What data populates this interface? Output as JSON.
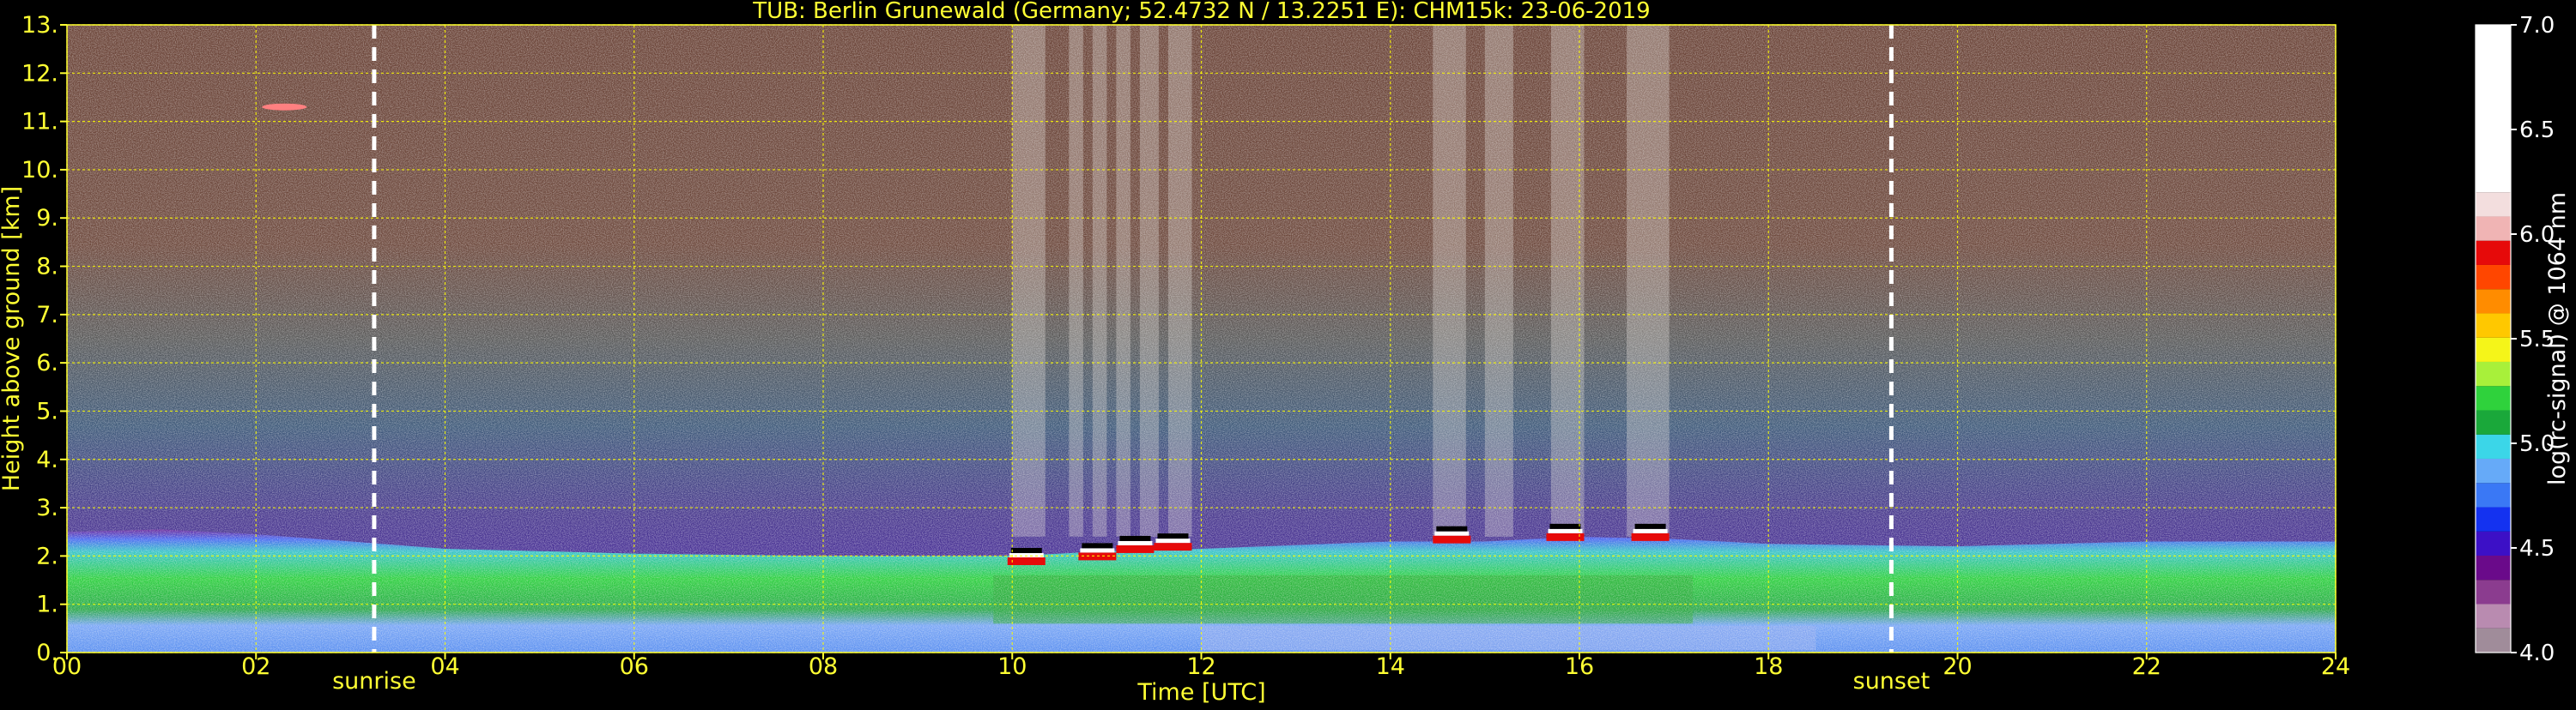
{
  "chart_data": {
    "type": "heatmap",
    "title": "TUB: Berlin Grunewald (Germany; 52.4732 N / 13.2251 E):    CHM15k: 23-06-2019",
    "xlabel": "Time [UTC]",
    "ylabel": "Height above ground [km]",
    "xlim": [
      0,
      24
    ],
    "ylim": [
      0,
      13
    ],
    "x_ticks": [
      "00",
      "02",
      "04",
      "06",
      "08",
      "10",
      "12",
      "14",
      "16",
      "18",
      "20",
      "22",
      "24"
    ],
    "y_ticks": [
      "0.",
      "1.",
      "2.",
      "3.",
      "4.",
      "5.",
      "6.",
      "7.",
      "8.",
      "9.",
      "10.",
      "11.",
      "12.",
      "13."
    ],
    "grid": true,
    "colorbar": {
      "label": "log(rc-signal) @ 1064 nm",
      "range": [
        4.0,
        7.0
      ],
      "ticks": [
        "4.0",
        "4.5",
        "5.0",
        "5.5",
        "6.0",
        "6.5",
        "7.0"
      ]
    },
    "annotations": [
      {
        "text": "sunrise",
        "x": 3.25
      },
      {
        "text": "sunset",
        "x": 19.3
      }
    ],
    "layers": {
      "boundary_layer_top_km": [
        [
          0,
          2.5
        ],
        [
          1,
          2.55
        ],
        [
          2,
          2.45
        ],
        [
          3,
          2.3
        ],
        [
          4,
          2.15
        ],
        [
          6,
          2.05
        ],
        [
          8,
          2.0
        ],
        [
          10,
          2.0
        ],
        [
          11,
          2.1
        ],
        [
          12,
          2.15
        ],
        [
          14,
          2.3
        ],
        [
          15,
          2.3
        ],
        [
          16,
          2.4
        ],
        [
          17,
          2.35
        ],
        [
          18,
          2.25
        ],
        [
          20,
          2.2
        ],
        [
          22,
          2.3
        ],
        [
          24,
          2.3
        ]
      ],
      "cloud_base_km": [
        {
          "x": 10.15,
          "y": 1.9
        },
        {
          "x": 10.9,
          "y": 2.0
        },
        {
          "x": 11.3,
          "y": 2.15
        },
        {
          "x": 11.7,
          "y": 2.2
        },
        {
          "x": 14.65,
          "y": 2.35
        },
        {
          "x": 15.85,
          "y": 2.4
        },
        {
          "x": 16.75,
          "y": 2.4
        }
      ],
      "cirrus_km": {
        "x": 2.3,
        "y": 11.3
      }
    },
    "colors": {
      "title": "#ffff33",
      "axis": "#ffff33",
      "grid": "#ffff00",
      "colorbar_text": "#ffffff",
      "colormap": [
        "#a08c9a",
        "#b98bb0",
        "#8b3c8f",
        "#6a0a8a",
        "#3c10c6",
        "#1432f0",
        "#3a78f5",
        "#66aaf8",
        "#3bd6e8",
        "#1aa83a",
        "#2fd23c",
        "#a8f03a",
        "#f5f519",
        "#ffc800",
        "#ff8c00",
        "#ff4600",
        "#e60a0a",
        "#f0b4b4",
        "#f3dede",
        "#ffffff"
      ]
    }
  }
}
